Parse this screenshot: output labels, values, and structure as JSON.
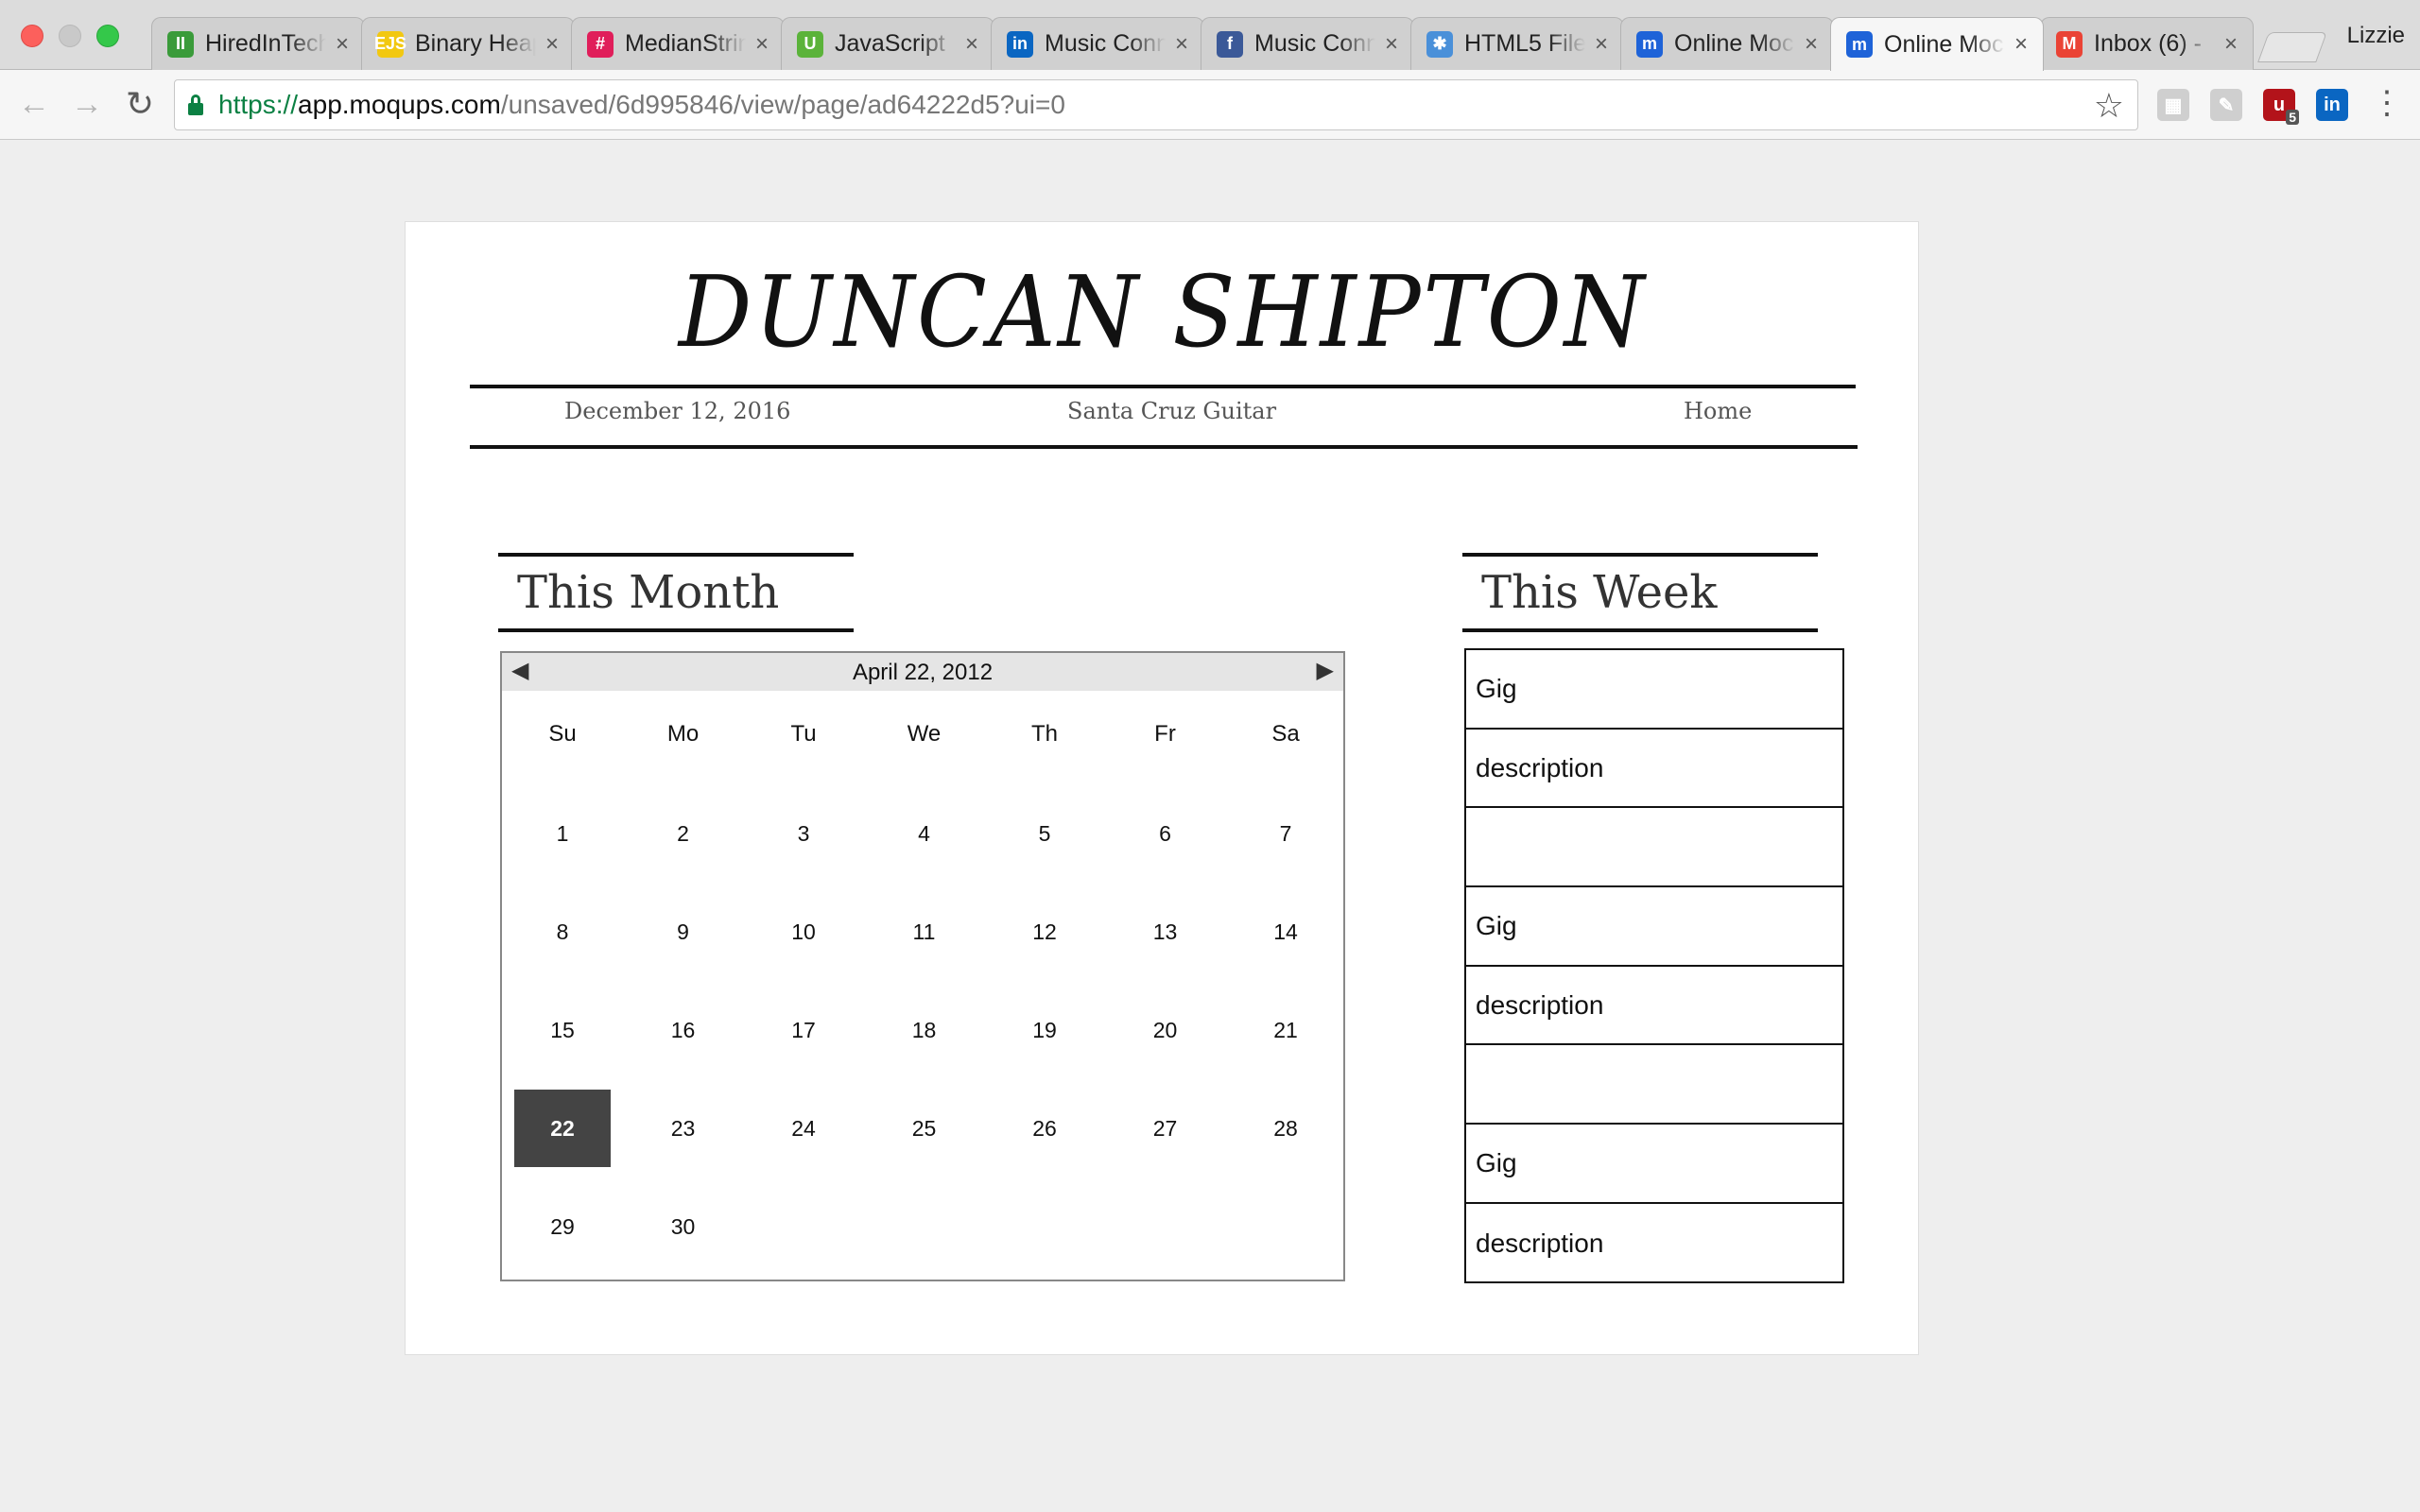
{
  "browser": {
    "tabs": [
      {
        "title": "HiredInTech",
        "favicon": "hiredintech-icon",
        "favicon_text": "II",
        "color": "#3a9b3a"
      },
      {
        "title": "Binary Heap",
        "favicon": "ejs-icon",
        "favicon_text": "EJS",
        "color": "#f2c811"
      },
      {
        "title": "MedianString",
        "favicon": "slack-icon",
        "favicon_text": "#",
        "color": "#e01e5a"
      },
      {
        "title": "JavaScript",
        "favicon": "udemy-icon",
        "favicon_text": "U",
        "color": "#5bb33a"
      },
      {
        "title": "Music Connect",
        "favicon": "linkedin-icon",
        "favicon_text": "in",
        "color": "#0a66c2"
      },
      {
        "title": "Music Connect",
        "favicon": "facebook-icon",
        "favicon_text": "f",
        "color": "#3b5998"
      },
      {
        "title": "HTML5 File",
        "favicon": "html5-file-icon",
        "favicon_text": "✱",
        "color": "#4a90d9"
      },
      {
        "title": "Online Mockup",
        "favicon": "moqups-icon",
        "favicon_text": "m",
        "color": "#1e63d8"
      },
      {
        "title": "Online Mockup",
        "favicon": "moqups-icon",
        "favicon_text": "m",
        "color": "#1e63d8",
        "active": true
      },
      {
        "title": "Inbox (6) - ",
        "favicon": "gmail-icon",
        "favicon_text": "M",
        "color": "#ea4335"
      }
    ],
    "profile_name": "Lizzie",
    "url": {
      "scheme": "https://",
      "host": "app.moqups.com",
      "path": "/unsaved/6d995846/view/page/ad64222d5?ui=0"
    },
    "extensions": [
      {
        "name": "extension-grid-icon",
        "text": "▦",
        "color": "#cfcfcf"
      },
      {
        "name": "extension-pen-icon",
        "text": "✎",
        "color": "#cfcfcf"
      },
      {
        "name": "ublock-icon",
        "text": "u",
        "color": "#b3131a",
        "badge": "5"
      },
      {
        "name": "linkedin-extension-icon",
        "text": "in",
        "color": "#0a66c2"
      }
    ]
  },
  "site": {
    "title": "DUNCAN SHIPTON",
    "nav": {
      "date": "December 12, 2016",
      "center": "Santa Cruz Guitar",
      "home": "Home"
    }
  },
  "month": {
    "heading": "This Month",
    "calendar_title": "April 22, 2012",
    "prev_arrow": "◀",
    "next_arrow": "▶",
    "weekdays": [
      "Su",
      "Mo",
      "Tu",
      "We",
      "Th",
      "Fr",
      "Sa"
    ],
    "days": [
      "1",
      "2",
      "3",
      "4",
      "5",
      "6",
      "7",
      "8",
      "9",
      "10",
      "11",
      "12",
      "13",
      "14",
      "15",
      "16",
      "17",
      "18",
      "19",
      "20",
      "21",
      "22",
      "23",
      "24",
      "25",
      "26",
      "27",
      "28",
      "29",
      "30"
    ],
    "first_weekday_index": 0,
    "selected_day": "22"
  },
  "week": {
    "heading": "This Week",
    "rows": [
      "Gig",
      "description",
      "",
      "Gig",
      "description",
      "",
      "Gig",
      "description"
    ]
  }
}
